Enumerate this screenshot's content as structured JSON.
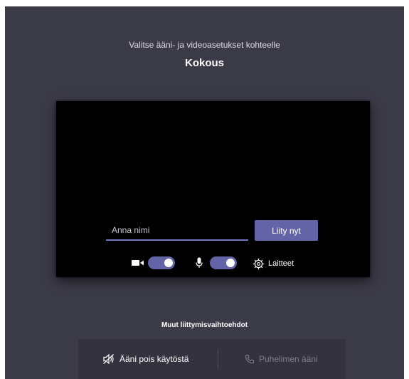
{
  "header": {
    "subtitle": "Valitse ääni- ja videoasetukset kohteelle",
    "meeting_title": "Kokous"
  },
  "preview": {
    "name_input": {
      "value": "",
      "placeholder": "Anna nimi"
    },
    "join_button_label": "Liity nyt",
    "controls": {
      "camera": {
        "icon": "camera-icon",
        "enabled": true
      },
      "microphone": {
        "icon": "mic-icon",
        "enabled": true
      },
      "devices": {
        "icon": "gear-icon",
        "label": "Laitteet"
      }
    }
  },
  "other_options": {
    "heading": "Muut liittymisvaihtoehdot",
    "items": [
      {
        "icon": "speaker-off-icon",
        "label": "Ääni pois käytöstä",
        "enabled": true
      },
      {
        "icon": "phone-icon",
        "label": "Puhelimen ääni",
        "enabled": false
      }
    ]
  },
  "colors": {
    "background": "#3b3a47",
    "accent": "#6264a7",
    "preview_background": "#000000",
    "options_bar": "#33323e",
    "disabled_text": "#7f7e8e"
  }
}
